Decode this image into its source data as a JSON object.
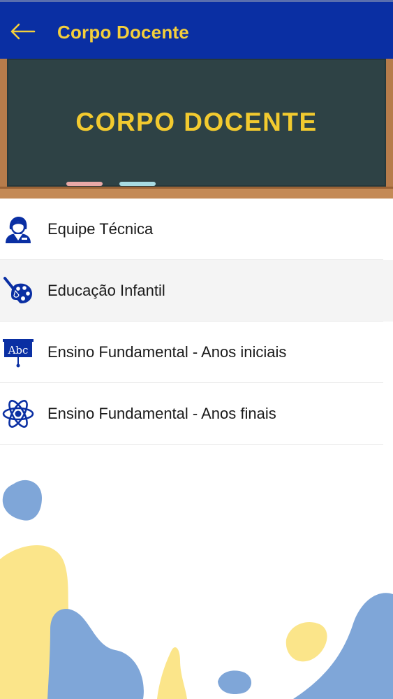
{
  "appbar": {
    "title": "Corpo Docente",
    "back_icon": "arrow-left-icon",
    "background": "#0a2fa3",
    "title_color": "#f4cf3b"
  },
  "banner": {
    "text": "CORPO DOCENTE",
    "board_color": "#2e4245",
    "frame_color": "#b77c4b",
    "text_color": "#f2ca2f"
  },
  "menu": {
    "items": [
      {
        "label": "Equipe Técnica",
        "icon": "teacher-icon"
      },
      {
        "label": "Educação Infantil",
        "icon": "palette-brush-icon"
      },
      {
        "label": "Ensino Fundamental - Anos iniciais",
        "icon": "abc-board-icon"
      },
      {
        "label": "Ensino Fundamental - Anos finais",
        "icon": "atom-icon"
      }
    ],
    "icon_color": "#0a2fa3"
  },
  "decor": {
    "blue": "#7fa6d8",
    "yellow": "#fbe58a"
  }
}
